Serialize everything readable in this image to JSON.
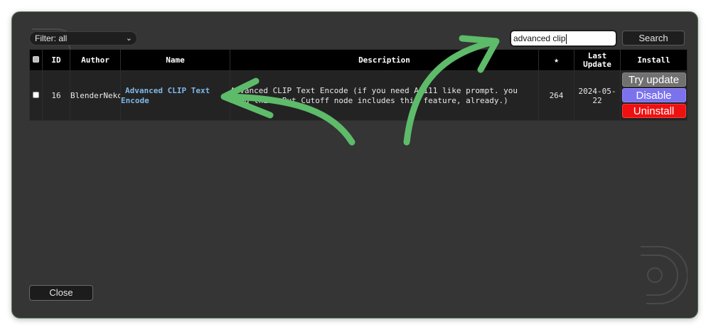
{
  "filter": {
    "selected": "Filter: all"
  },
  "search": {
    "value": "advanced clip",
    "button_label": "Search"
  },
  "table": {
    "headers": {
      "id": "ID",
      "author": "Author",
      "name": "Name",
      "description": "Description",
      "stars": "★",
      "last_update": "Last Update",
      "install": "Install"
    },
    "rows": [
      {
        "id": "16",
        "author": "BlenderNeko",
        "name": "Advanced CLIP Text Encode",
        "description": "Advanced CLIP Text Encode (if you need A1111 like prompt. you need this. But Cutoff node includes this feature, already.)",
        "stars": "264",
        "last_update": "2024-05-22",
        "actions": {
          "try_update": "Try update",
          "disable": "Disable",
          "uninstall": "Uninstall"
        }
      }
    ]
  },
  "close_label": "Close",
  "colors": {
    "dialog_bg": "#353535",
    "header_bg": "#000000",
    "row_bg": "#232323",
    "link": "#7fb8e8",
    "disable": "#7c72ee",
    "uninstall": "#ee1111",
    "try_update": "#717171",
    "annotation_arrow": "#5dbb6a"
  },
  "icons": {
    "filter_dropdown": "chevron-down-icon",
    "watermark": "logo-watermark-icon",
    "annotation": "curved-arrow-icon"
  }
}
